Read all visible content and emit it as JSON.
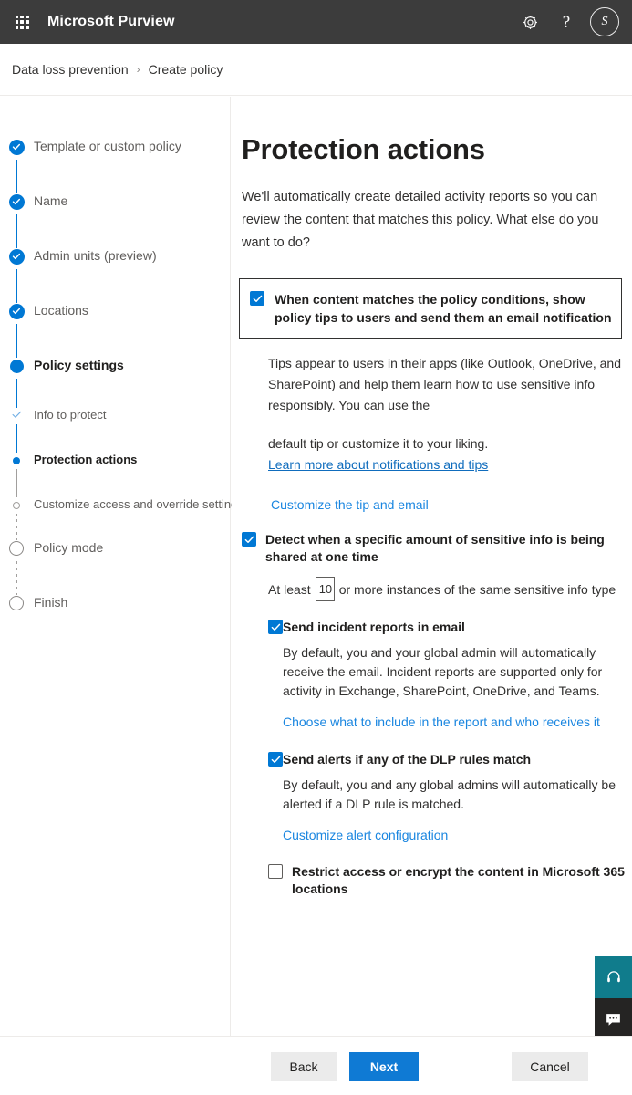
{
  "suitebar": {
    "waffle_name": "app-launcher",
    "title": "Microsoft Purview",
    "settings_icon": "gear-icon",
    "help_icon": "question-mark-icon",
    "avatar_initial": "S",
    "brand_bg": "#3c3c3c"
  },
  "breadcrumb": {
    "items": [
      {
        "label": "Data loss prevention"
      },
      {
        "label": "Create policy"
      }
    ],
    "separator": "›"
  },
  "wizard": {
    "steps": [
      {
        "label": "Template or custom policy",
        "state": "done",
        "level": "top"
      },
      {
        "label": "Name",
        "state": "done",
        "level": "top"
      },
      {
        "label": "Admin units (preview)",
        "state": "done",
        "level": "top"
      },
      {
        "label": "Locations",
        "state": "done",
        "level": "top"
      },
      {
        "label": "Policy settings",
        "state": "current",
        "level": "top"
      },
      {
        "label": "Info to protect",
        "state": "sub-done",
        "level": "sub"
      },
      {
        "label": "Protection actions",
        "state": "sub-current",
        "level": "sub"
      },
      {
        "label": "Customize access and override settings",
        "state": "sub-pending",
        "level": "sub"
      },
      {
        "label": "Policy mode",
        "state": "pending",
        "level": "top"
      },
      {
        "label": "Finish",
        "state": "pending",
        "level": "top"
      }
    ],
    "accent_color": "#0078d4"
  },
  "main": {
    "title": "Protection actions",
    "description": "We'll automatically create detailed activity reports so you can review the content that matches this policy. What else do you want to do?",
    "policy_tips": {
      "checked": true,
      "label": "When content matches the policy conditions, show policy tips to users and send them an email notification",
      "paragraph": "Tips appear to users in their apps (like Outlook, OneDrive, and SharePoint) and help them learn how to use sensitive info responsibly. You can use the",
      "paragraph2": "default tip or customize it to your liking.",
      "learn_more_link": "Learn more about notifications and tips",
      "customize_link": "Customize the tip and email"
    },
    "detect_amount": {
      "checked": true,
      "label": "Detect when a specific amount of sensitive info is being shared at one time",
      "prefix_text": "At least",
      "instances_value": "10",
      "suffix_text": "or more instances of the same sensitive info type"
    },
    "incident_reports": {
      "checked": true,
      "label": "Send incident reports in email",
      "description": "By default, you and your global admin will automatically receive the email. Incident reports are supported only for activity in Exchange, SharePoint, OneDrive, and Teams.",
      "link": "Choose what to include in the report and who receives it"
    },
    "alerts": {
      "checked": true,
      "label": "Send alerts if any of the DLP rules match",
      "description": "By default, you and any global admins will automatically be alerted if a DLP rule is matched.",
      "link": "Customize alert configuration"
    },
    "restrict_access": {
      "checked": false,
      "label": "Restrict access or encrypt the content in Microsoft 365 locations"
    }
  },
  "widgets": {
    "support_icon": "headset-icon",
    "feedback_icon": "chat-feedback-icon",
    "support_color": "#107c8c",
    "feedback_color": "#252423"
  },
  "footer": {
    "back_label": "Back",
    "next_label": "Next",
    "cancel_label": "Cancel",
    "primary_color": "#0f7ad4"
  }
}
